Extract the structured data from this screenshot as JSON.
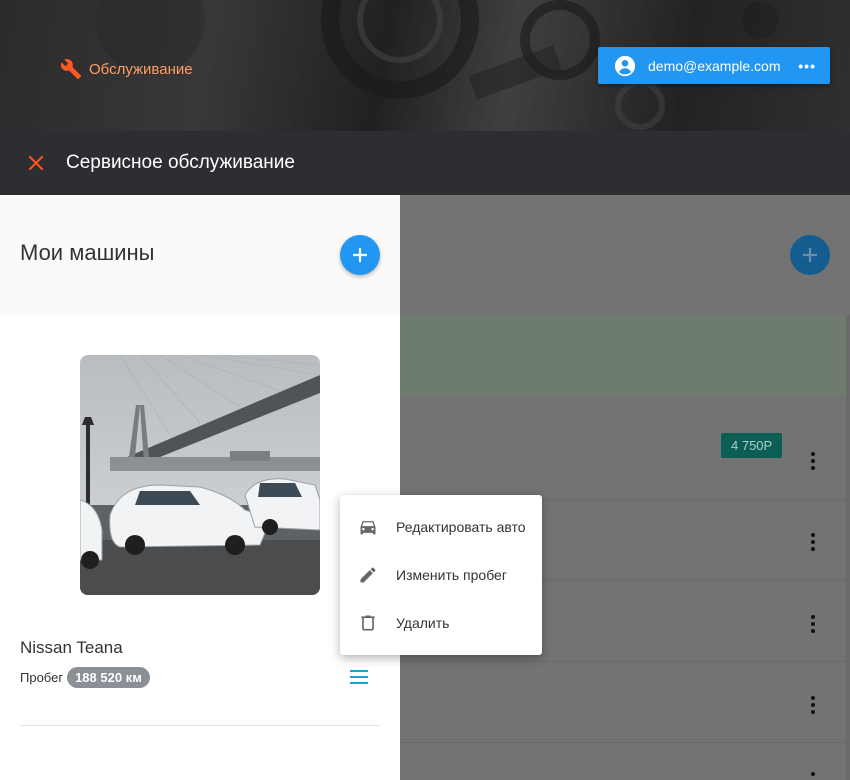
{
  "header": {
    "brand_label": "Обслуживание",
    "user_email": "demo@example.com",
    "more_label": "•••",
    "accent": "#ff5722",
    "user_button_color": "#2196f3"
  },
  "toolbar": {
    "title": "Сервисное обслуживание"
  },
  "drawer": {
    "title": "Мои машины",
    "car": {
      "name": "Nissan Teana",
      "mileage_label": "Пробег",
      "mileage_value": "188 520 км"
    }
  },
  "context_menu": {
    "items": [
      {
        "label": "Редактировать авто",
        "icon": "car-icon"
      },
      {
        "label": "Изменить пробег",
        "icon": "pencil-icon"
      },
      {
        "label": "Удалить",
        "icon": "trash-icon"
      }
    ]
  },
  "background": {
    "price_badge": "4 750Р"
  }
}
